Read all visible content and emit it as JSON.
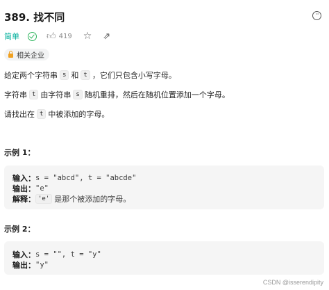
{
  "problem": {
    "title": "389. 找不同",
    "difficulty": "简单",
    "likes": "419",
    "tag": "相关企业"
  },
  "description": {
    "p1": {
      "before": "给定两个字符串",
      "code1": "s",
      "mid": "和",
      "code2": "t",
      "after": "，它们只包含小写字母。"
    },
    "p2": {
      "before": "字符串",
      "code1": "t",
      "mid": "由字符串",
      "code2": "s",
      "after": "随机重排，然后在随机位置添加一个字母。"
    },
    "p3": {
      "before": "请找出在",
      "code1": "t",
      "after": "中被添加的字母。"
    }
  },
  "examples": [
    {
      "title": "示例 1：",
      "input_label": "输入：",
      "input_value": "s = \"abcd\", t = \"abcde\"",
      "output_label": "输出：",
      "output_value": "\"e\"",
      "explain_label": "解释：",
      "explain_code": "'e'",
      "explain_text": "是那个被添加的字母。"
    },
    {
      "title": "示例 2：",
      "input_label": "输入：",
      "input_value": "s = \"\", t = \"y\"",
      "output_label": "输出：",
      "output_value": "\"y\""
    }
  ],
  "watermark": "CSDN @isserendipity",
  "icons": [
    "more-icon",
    "check-icon",
    "thumbs-up-icon",
    "star-icon",
    "share-icon",
    "lock-icon"
  ],
  "colors": {
    "difficulty": "#00af9b",
    "solved": "#2db55d",
    "tag_lock": "#f0a020",
    "example_bg": "#f5f5f5"
  }
}
